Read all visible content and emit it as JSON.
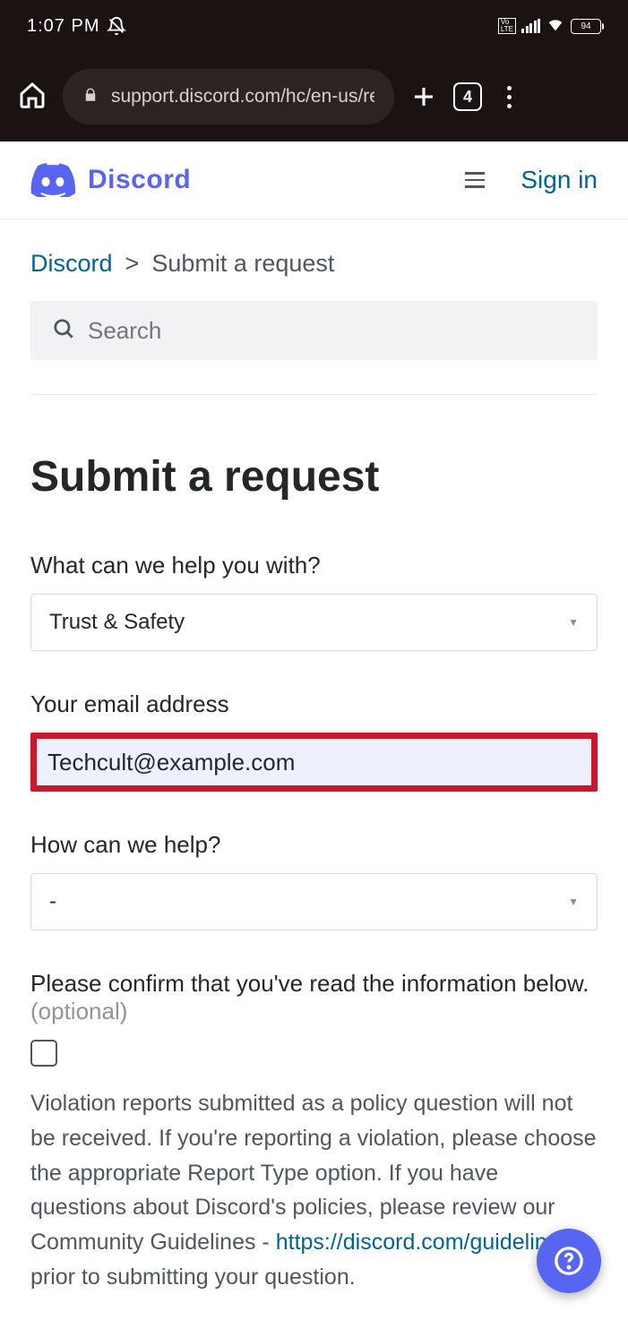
{
  "status": {
    "time": "1:07 PM",
    "battery_pct": "94"
  },
  "browser": {
    "url": "support.discord.com/hc/en-us/requ",
    "tab_count": "4"
  },
  "header": {
    "brand": "Discord",
    "signin": "Sign in"
  },
  "breadcrumb": {
    "root": "Discord",
    "sep": ">",
    "current": "Submit a request"
  },
  "search": {
    "placeholder": "Search"
  },
  "page": {
    "title": "Submit a request"
  },
  "form": {
    "help_with_label": "What can we help you with?",
    "help_with_value": "Trust & Safety",
    "email_label": "Your email address",
    "email_value": "Techcult@example.com",
    "how_help_label": "How can we help?",
    "how_help_value": "-",
    "confirm_label_main": "Please confirm that you've read the information below. ",
    "confirm_label_optional": "(optional)",
    "info_text_pre": "Violation reports submitted as a policy question will not be received. If you're reporting a violation, please choose the appropriate Report Type option. If you have questions about Discord's policies, please review our Community Guidelines - ",
    "info_link": "https://discord.com/guidelines",
    "info_text_post": " - prior to submitting your question."
  }
}
